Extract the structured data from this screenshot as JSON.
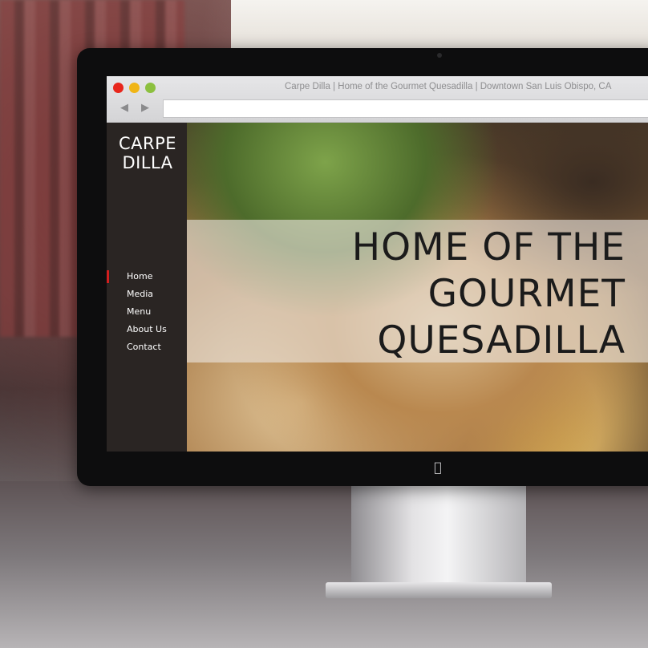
{
  "browser": {
    "title": "Carpe Dilla | Home of the Gourmet Quesadilla | Downtown San Luis Obispo, CA",
    "url": "",
    "back_icon": "back-arrow-icon",
    "forward_icon": "forward-arrow-icon",
    "window_controls": {
      "close": "#e8261c",
      "minimize": "#f0b516",
      "zoom": "#8cc03f"
    }
  },
  "site": {
    "logo_line1": "CARPE",
    "logo_line2": "DILLA",
    "nav": [
      {
        "label": "Home",
        "active": true
      },
      {
        "label": "Media",
        "active": false
      },
      {
        "label": "Menu",
        "active": false
      },
      {
        "label": "About Us",
        "active": false
      },
      {
        "label": "Contact",
        "active": false
      }
    ],
    "hero": {
      "line1": "HOME OF THE",
      "line2": "GOURMET",
      "line3": "QUESADILLA"
    },
    "colors": {
      "sidebar": "#2a2523",
      "accent": "#d21f1f"
    }
  }
}
